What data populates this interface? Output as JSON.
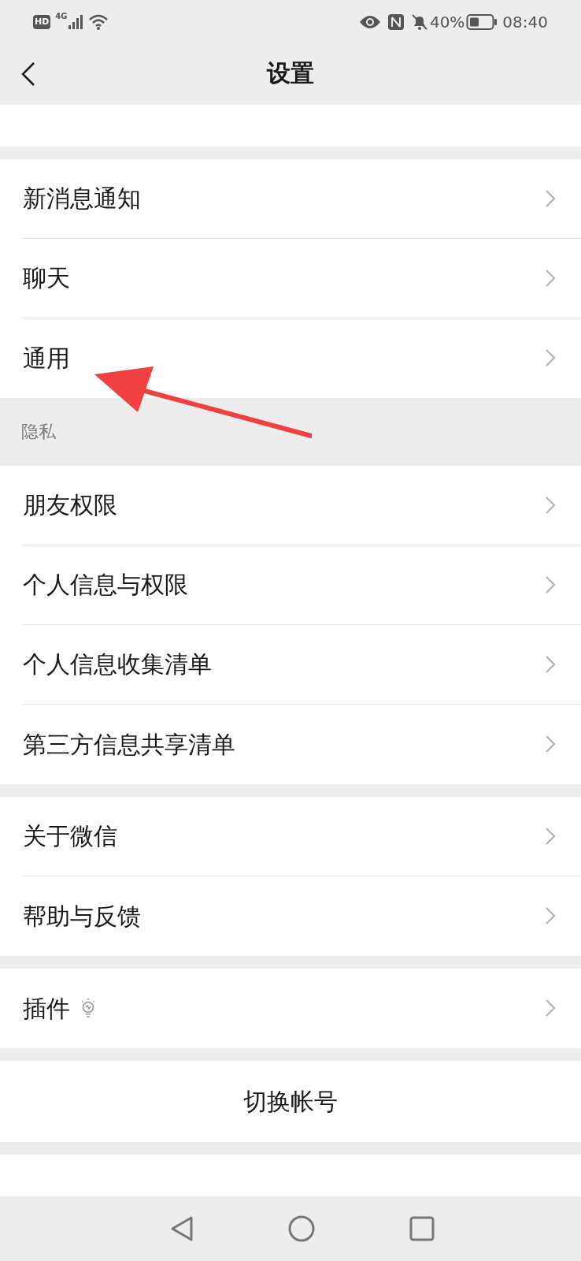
{
  "status_bar": {
    "network_badge": "HD",
    "network_type": "4G",
    "battery": "40%",
    "time": "08:40"
  },
  "header": {
    "title": "设置"
  },
  "groups": [
    {
      "items": [
        {
          "kind": "clipped"
        }
      ]
    },
    {
      "items": [
        {
          "kind": "link",
          "label": "新消息通知"
        },
        {
          "kind": "link",
          "label": "聊天"
        },
        {
          "kind": "link",
          "label": "通用"
        }
      ]
    },
    {
      "label": "隐私",
      "items": [
        {
          "kind": "link",
          "label": "朋友权限"
        },
        {
          "kind": "link",
          "label": "个人信息与权限"
        },
        {
          "kind": "link",
          "label": "个人信息收集清单"
        },
        {
          "kind": "link",
          "label": "第三方信息共享清单"
        }
      ]
    },
    {
      "items": [
        {
          "kind": "link",
          "label": "关于微信"
        },
        {
          "kind": "link",
          "label": "帮助与反馈"
        }
      ]
    },
    {
      "items": [
        {
          "kind": "link_with_icon",
          "label": "插件"
        }
      ]
    },
    {
      "items": [
        {
          "kind": "action",
          "label": "切换帐号"
        }
      ]
    },
    {
      "items": [
        {
          "kind": "clipped"
        }
      ]
    }
  ]
}
